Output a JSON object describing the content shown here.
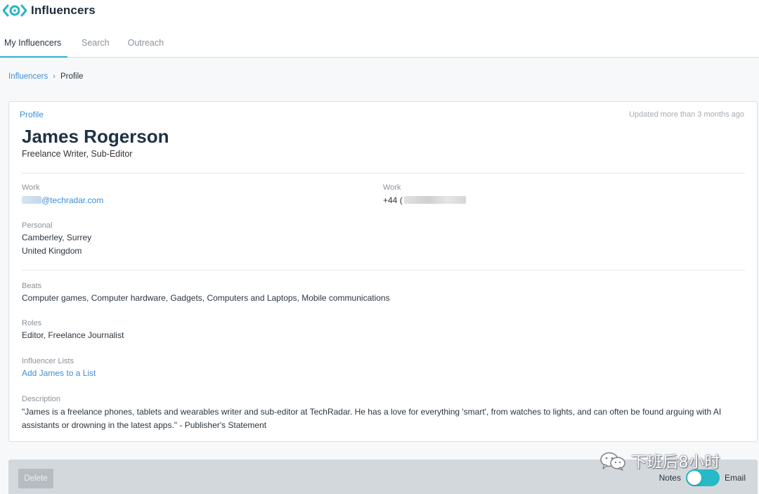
{
  "app": {
    "title": "Influencers"
  },
  "tabs": [
    {
      "label": "My Influencers",
      "active": true
    },
    {
      "label": "Search",
      "active": false
    },
    {
      "label": "Outreach",
      "active": false
    }
  ],
  "breadcrumb": {
    "parent": "Influencers",
    "separator": "›",
    "current": "Profile"
  },
  "profile": {
    "section_label": "Profile",
    "updated": "Updated more than 3 months ago",
    "name": "James Rogerson",
    "title": "Freelance Writer, Sub-Editor",
    "work_email": {
      "label": "Work",
      "value": "@techradar.com"
    },
    "work_phone": {
      "label": "Work",
      "value": "+44 ("
    },
    "personal": {
      "label": "Personal",
      "line1": "Camberley, Surrey",
      "line2": "United Kingdom"
    },
    "beats": {
      "label": "Beats",
      "value": "Computer games, Computer hardware, Gadgets, Computers and Laptops, Mobile communications"
    },
    "roles": {
      "label": "Roles",
      "value": "Editor, Freelance Journalist"
    },
    "lists": {
      "label": "Influencer Lists",
      "link": "Add James to a List"
    },
    "description": {
      "label": "Description",
      "value": "\"James is a freelance phones, tablets and wearables writer and sub-editor at TechRadar. He has a love for everything 'smart', from watches to lights, and can often be found arguing with AI assistants or drowning in the latest apps.\" - Publisher's Statement"
    }
  },
  "footer": {
    "delete_label": "Delete",
    "toggle_left": "Notes",
    "toggle_right": "Email",
    "toggle_on": true
  },
  "watermark": {
    "text": "下班后8小时"
  },
  "colors": {
    "accent": "#27b6c4",
    "link": "#3d8fd6",
    "heading": "#1f3243"
  }
}
